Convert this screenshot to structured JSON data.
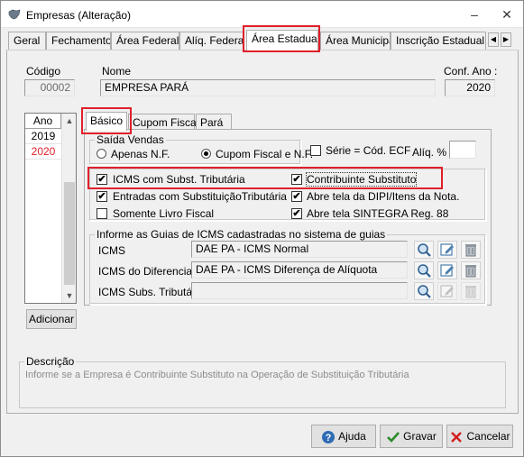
{
  "window": {
    "title": "Empresas (Alteração)",
    "minimize": "–",
    "close": "✕"
  },
  "top_tabs": [
    {
      "label": "Geral"
    },
    {
      "label": "Fechamento"
    },
    {
      "label": "Área Federal"
    },
    {
      "label": "Alíq. Federais"
    },
    {
      "label": "Área Estadual"
    },
    {
      "label": "Área Municipal"
    },
    {
      "label": "Inscrição Estadual S"
    }
  ],
  "header": {
    "codigo_label": "Código",
    "codigo_value": "00002",
    "nome_label": "Nome",
    "nome_value": "EMPRESA PARÁ",
    "conf_ano_label": "Conf. Ano :",
    "conf_ano_value": "2020"
  },
  "year_list": {
    "header": "Ano",
    "rows": [
      {
        "year": "2019",
        "color": "#000000"
      },
      {
        "year": "2020",
        "color": "#e0202a"
      }
    ],
    "add_button": "Adicionar"
  },
  "inner_tabs": [
    {
      "label": "Básico"
    },
    {
      "label": "Cupom Fiscal"
    },
    {
      "label": "Pará"
    }
  ],
  "saida_vendas": {
    "title": "Saída Vendas",
    "option_nf": "Apenas N.F.",
    "option_cupom": "Cupom Fiscal e N.F.",
    "serie_label": "Série = Cód. ECF",
    "aliq_label": "Alíq. %",
    "aliq_value": ""
  },
  "options": {
    "icms_subst": "ICMS com Subst. Tributária",
    "contribuinte": "Contribuinte Substituto",
    "entradas": "Entradas com SubstituiçãoTributária",
    "abre_dipi": "Abre tela da DIPI/Itens da Nota.",
    "somente_livro": "Somente Livro Fiscal",
    "abre_sintegra": "Abre tela SINTEGRA Reg. 88"
  },
  "guias": {
    "title": "Informe as Guias de ICMS cadastradas no sistema de guias",
    "rows": [
      {
        "label": "ICMS",
        "value": "DAE PA - ICMS Normal"
      },
      {
        "label": "ICMS do Diferencial",
        "value": "DAE PA - ICMS Diferença de Alíquota"
      },
      {
        "label": "ICMS Subs. Tributária",
        "value": ""
      }
    ]
  },
  "descricao": {
    "label": "Descrição",
    "text": "Informe se a Empresa é Contribuinte Substituto na Operação de Substituição Tributária"
  },
  "footer": {
    "ajuda": "Ajuda",
    "gravar": "Gravar",
    "cancelar": "Cancelar"
  },
  "colors": {
    "highlight": "#e0202a",
    "accent": "#1a5fb4"
  }
}
